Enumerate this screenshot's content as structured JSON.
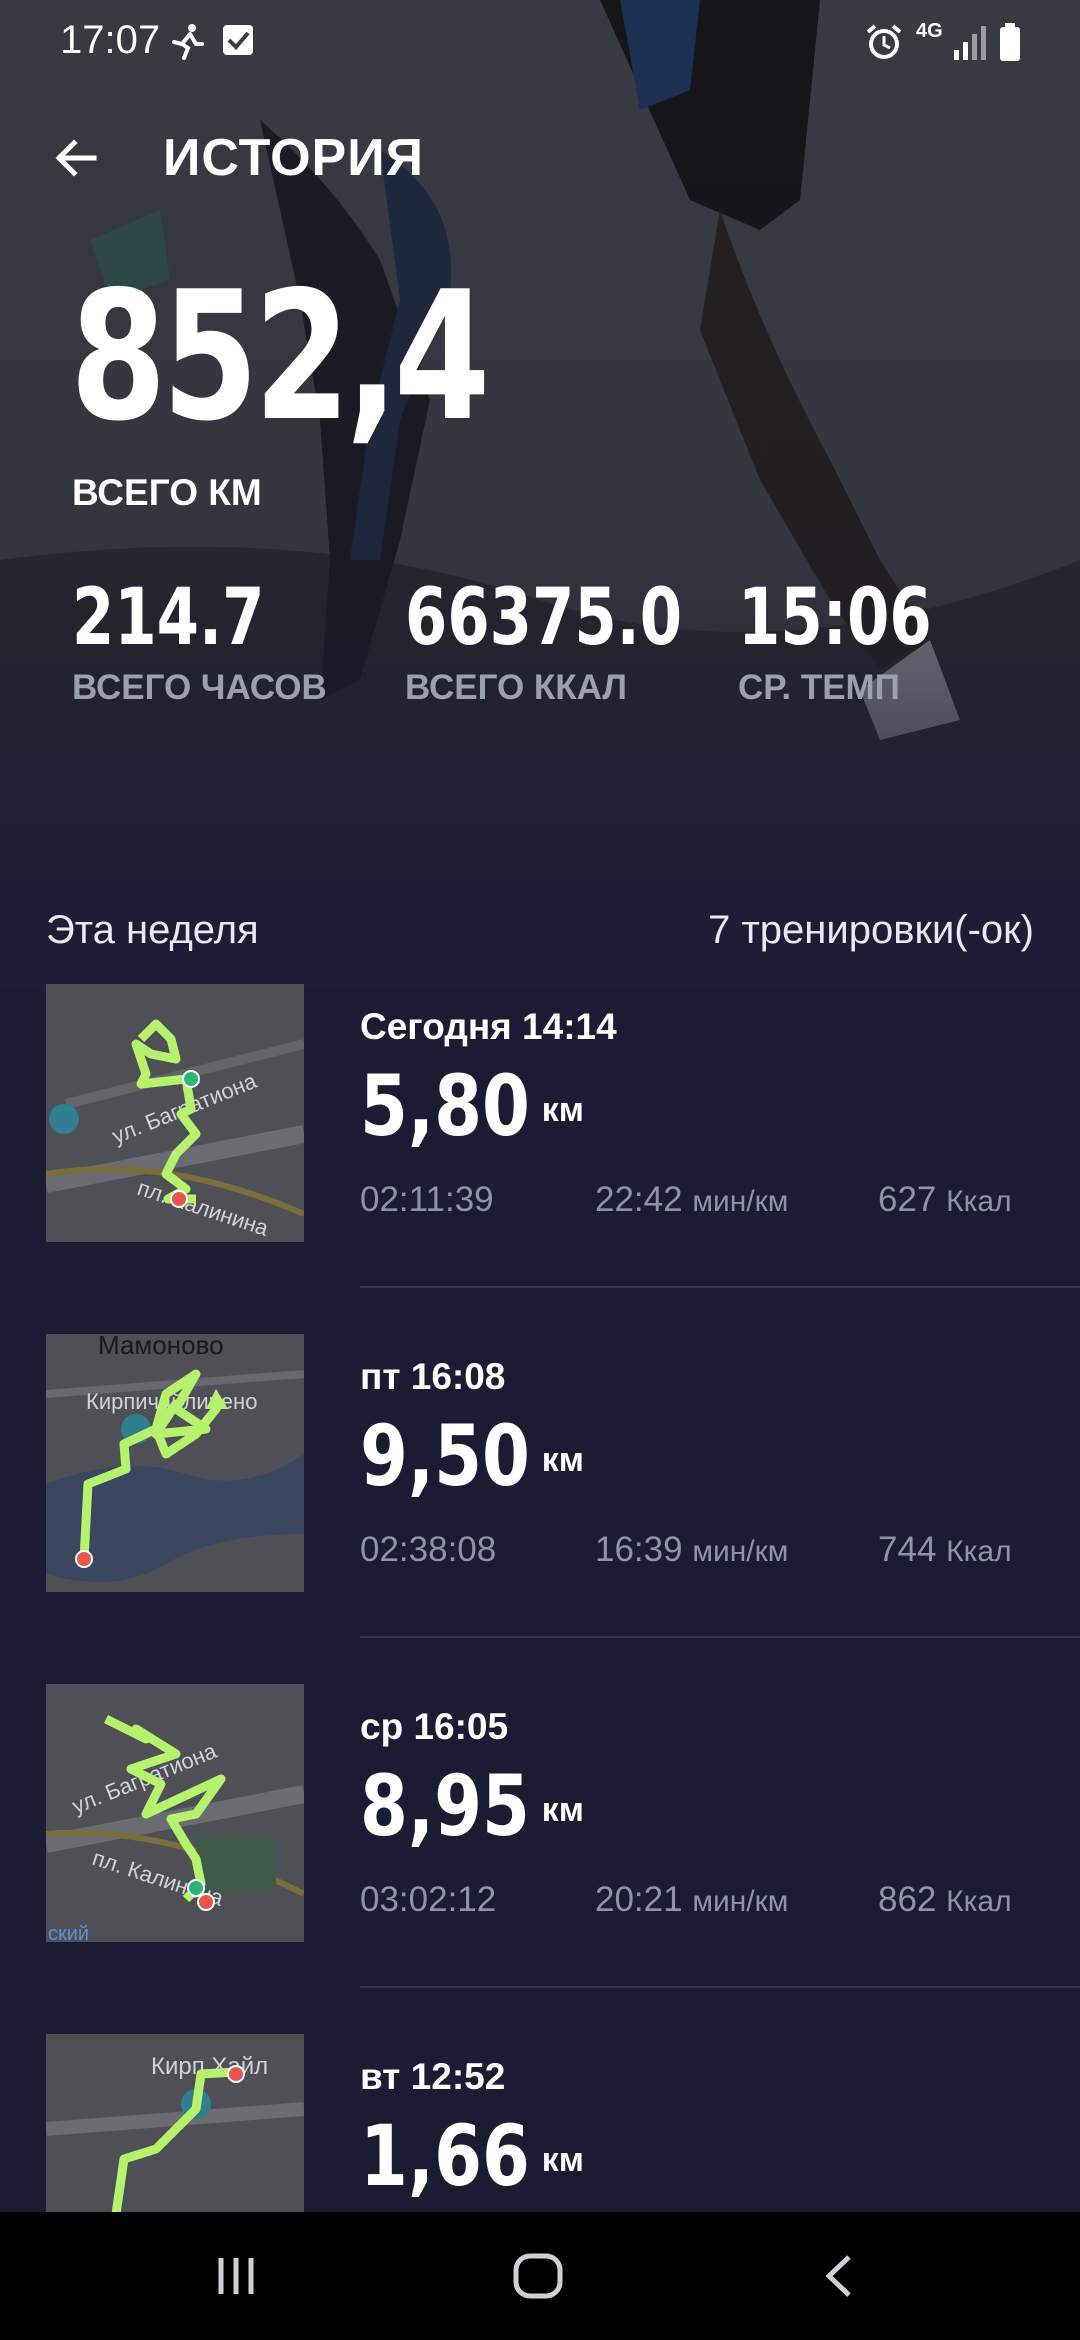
{
  "status": {
    "time": "17:07",
    "network": "4G"
  },
  "header": {
    "title": "ИСТОРИЯ"
  },
  "summary": {
    "total_km": "852,4",
    "total_km_label": "ВСЕГО КМ",
    "stats": [
      {
        "value": "214.7",
        "label": "ВСЕГО ЧАСОВ"
      },
      {
        "value": "66375.0",
        "label": "ВСЕГО ККАЛ"
      },
      {
        "value": "15:06",
        "label": "СР. ТЕМП"
      }
    ]
  },
  "week": {
    "title": "Эта неделя",
    "count": "7 тренировки(-ок)"
  },
  "runs": [
    {
      "date": "Сегодня 14:14",
      "distance": "5,80",
      "unit": "км",
      "duration": "02:11:39",
      "pace": "22:42",
      "pace_unit": "мин/км",
      "kcal": "627",
      "kcal_unit": "Ккал",
      "map_labels": [
        "ул. Багратиона",
        "пл. Калинина"
      ]
    },
    {
      "date": "пт 16:08",
      "distance": "9,50",
      "unit": "км",
      "duration": "02:38:08",
      "pace": "16:39",
      "pace_unit": "мин/км",
      "kcal": "744",
      "kcal_unit": "Ккал",
      "map_labels": [
        "Мамоново",
        "Кирпичайлинено"
      ]
    },
    {
      "date": "ср 16:05",
      "distance": "8,95",
      "unit": "км",
      "duration": "03:02:12",
      "pace": "20:21",
      "pace_unit": "мин/км",
      "kcal": "862",
      "kcal_unit": "Ккал",
      "map_labels": [
        "ул. Багратиона",
        "пл. Калинина",
        "ский"
      ]
    },
    {
      "date": "вт 12:52",
      "distance": "1,66",
      "unit": "км",
      "map_labels": [
        "Кирп Хайл"
      ]
    }
  ],
  "colors": {
    "accent_track": "#b6f26e",
    "start_dot": "#2bb673",
    "end_dot": "#e8564a",
    "list_bg": "#1b1b33"
  }
}
